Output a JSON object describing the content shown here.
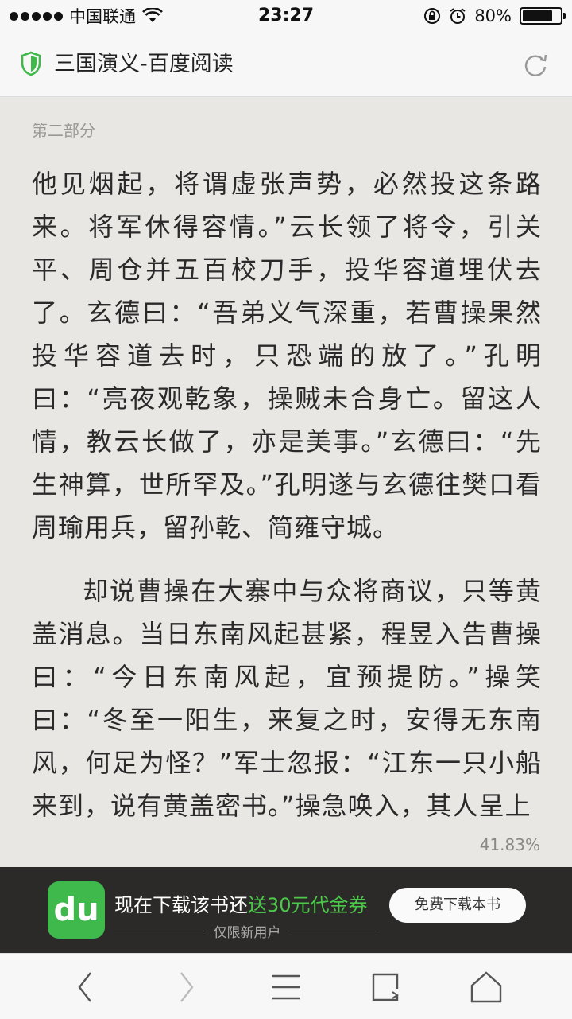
{
  "status_bar": {
    "carrier": "中国联通",
    "time": "23:27",
    "battery_percent": "80%",
    "battery_level": 0.8
  },
  "header": {
    "title": "三国演义-百度阅读",
    "icons": [
      "shield-icon",
      "reload-icon"
    ]
  },
  "reader": {
    "section_label": "第二部分",
    "paragraphs": [
      "他见烟起，将谓虚张声势，必然投这条路来。将军休得容情。”云长领了将令，引关平、周仓并五百校刀手，投华容道埋伏去了。玄德曰：“吾弟义气深重，若曹操果然投华容道去时，只恐端的放了。”孔明曰：“亮夜观乾象，操贼未合身亡。留这人情，教云长做了，亦是美事。”玄德曰：“先生神算，世所罕及。”孔明遂与玄德往樊口看周瑜用兵，留孙乾、简雍守城。",
      "却说曹操在大寨中与众将商议，只等黄盖消息。当日东南风起甚紧，程昱入告曹操曰：“今日东南风起，宜预提防。”操笑曰：“冬至一阳生，来复之时，安得无东南风，何足为怪？”军士忽报：“江东一只小船来到，说有黄盖密书。”操急唤入，其人呈上"
    ],
    "progress": "41.83%"
  },
  "banner": {
    "logo_text": "du",
    "text_prefix": "现在下载该书还",
    "text_highlight": "送30元代金券",
    "subtext": "仅限新用户",
    "button_label": "免费下载本书",
    "highlight_color": "#4cc94a"
  },
  "toolbar": {
    "icons": [
      "back-icon",
      "forward-icon",
      "menu-icon",
      "tabs-icon",
      "home-icon"
    ]
  }
}
